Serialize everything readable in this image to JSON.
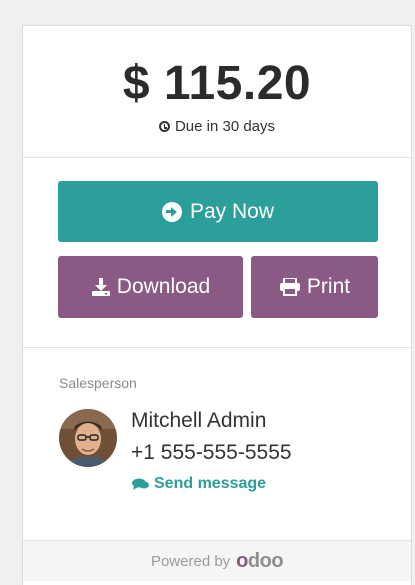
{
  "amount": "$ 115.20",
  "due_text": "Due in 30 days",
  "actions": {
    "pay_label": "Pay Now",
    "download_label": "Download",
    "print_label": "Print"
  },
  "salesperson": {
    "label": "Salesperson",
    "name": "Mitchell Admin",
    "phone": "+1 555-555-5555",
    "send_message": "Send message"
  },
  "footer": {
    "powered_by": "Powered by",
    "logo_text": "odoo"
  },
  "colors": {
    "pay_button": "#2c9f9b",
    "secondary_buttons": "#8a5a84",
    "link": "#2c9f9b",
    "logo_purple": "#875a7b",
    "logo_grey": "#8f8f8f"
  },
  "icons": {
    "due": "clock-icon",
    "pay": "arrow-circle-right-icon",
    "download": "download-icon",
    "print": "print-icon",
    "send_message": "comments-icon"
  }
}
